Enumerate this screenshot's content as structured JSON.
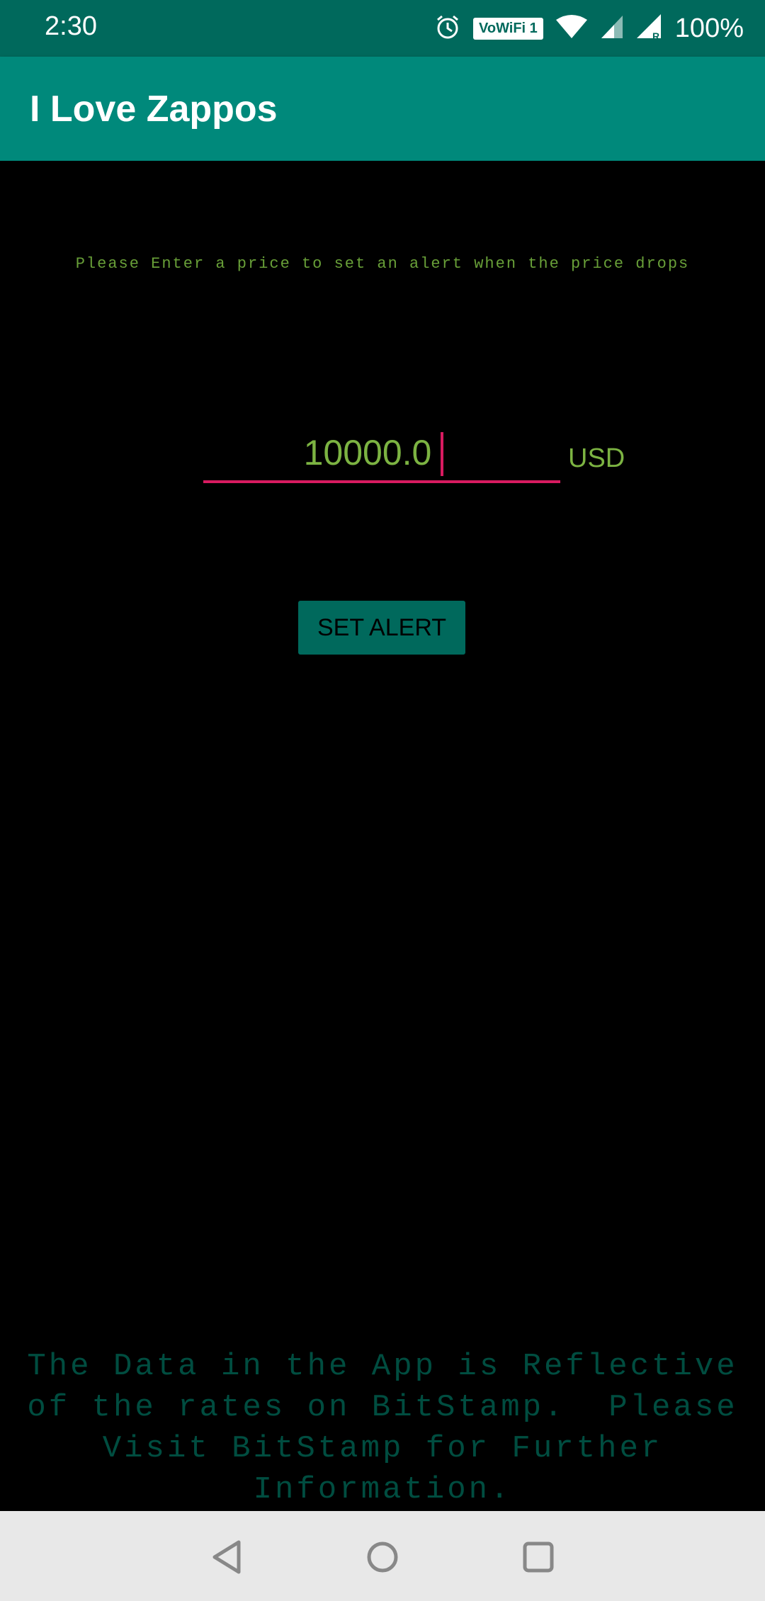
{
  "status_bar": {
    "time": "2:30",
    "icons": [
      "alarm-icon",
      "vowifi-icon",
      "wifi-icon",
      "cell-signal-icon",
      "cell-signal-roaming-icon"
    ],
    "vowifi_label": "VoWiFi 1",
    "battery": "100%"
  },
  "app_bar": {
    "title": "I Love Zappos",
    "background_color": "#00897b"
  },
  "main": {
    "prompt": "Please Enter a price to set an alert when the price drops",
    "price_value": "10000.0",
    "currency": "USD",
    "button_label": "SET ALERT",
    "accent_color": "#d81b60",
    "text_color": "#7cb342"
  },
  "footer": {
    "line1": "The Data in the App is Reflective",
    "line2": "of the rates on BitStamp.  Please",
    "line3": "Visit BitStamp for Further",
    "line4": "Information."
  },
  "nav_bar": {
    "icons": [
      "back-icon",
      "home-icon",
      "recents-icon"
    ]
  }
}
